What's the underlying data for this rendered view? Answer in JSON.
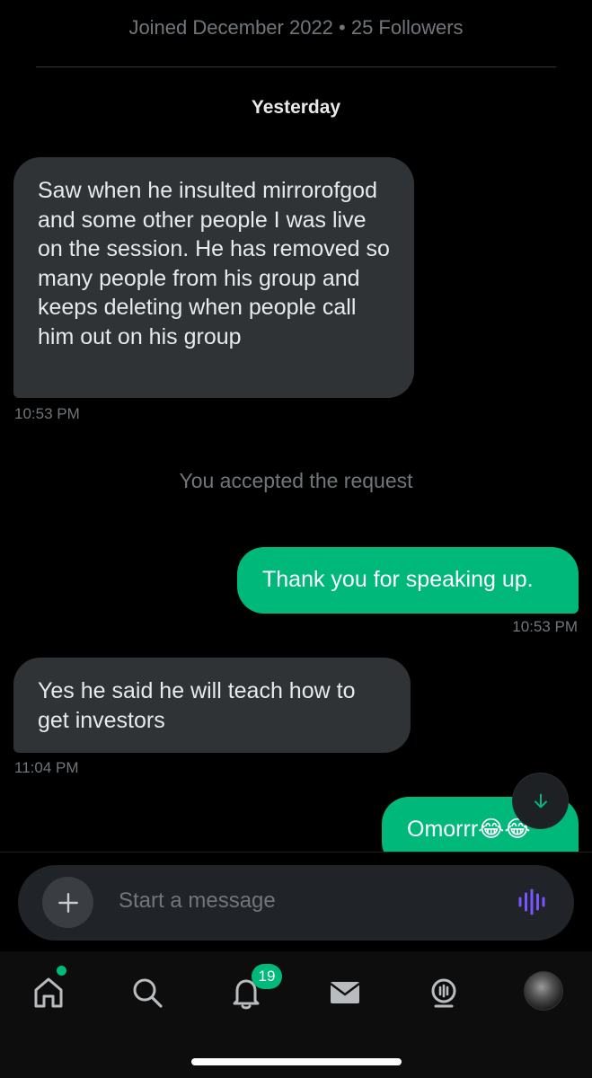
{
  "header": {
    "joined_text": "Joined December 2022 • 25 Followers",
    "day_label": "Yesterday"
  },
  "messages": [
    {
      "side": "incoming",
      "text": "Saw when he insulted mirrorofgod and some other people I was live on the session. He has removed so many people from his group and keeps deleting when people call him out on his group",
      "time": "10:53 PM"
    },
    {
      "side": "outgoing",
      "text": "Thank you for speaking up.",
      "time": "10:53 PM"
    },
    {
      "side": "incoming",
      "text": "Yes he said he will teach how to get investors",
      "time": "11:04 PM"
    },
    {
      "side": "outgoing",
      "text": "Omorrr😂😂",
      "time": ""
    }
  ],
  "system_message": "You accepted the request",
  "composer": {
    "placeholder": "Start a message"
  },
  "tabbar": {
    "notifications_badge": "19",
    "items": [
      "home-icon",
      "search-icon",
      "bell-icon",
      "mail-icon",
      "spaces-icon",
      "avatar"
    ]
  },
  "colors": {
    "accent": "#00ba7c",
    "incoming_bubble": "#2f3336",
    "outgoing_bubble": "#00b87a",
    "voice_icon": "#7856ff",
    "background": "#000000"
  }
}
